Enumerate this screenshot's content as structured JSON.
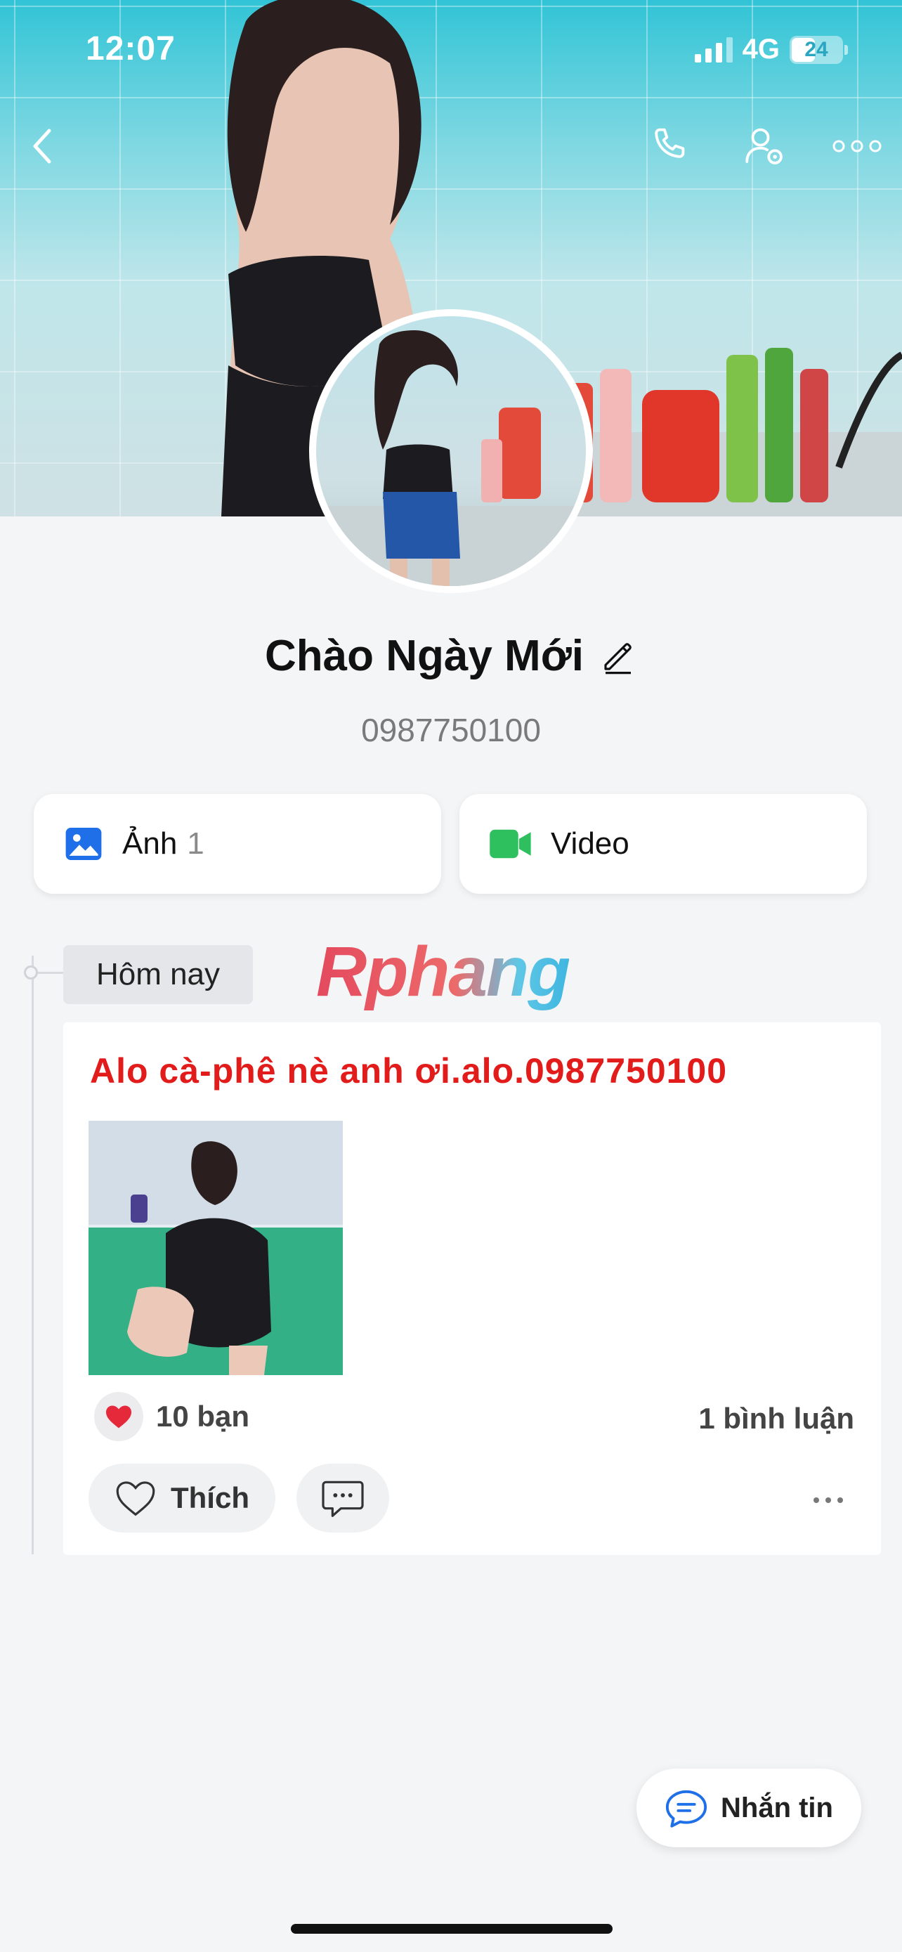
{
  "status": {
    "time": "12:07",
    "network": "4G",
    "battery": "24"
  },
  "profile": {
    "name": "Chào Ngày Mới",
    "phone": "0987750100"
  },
  "media": {
    "photos_label": "Ảnh",
    "photos_count": "1",
    "video_label": "Video"
  },
  "timeline": {
    "date_chip": "Hôm nay",
    "watermark": "Rphang"
  },
  "post": {
    "text": "Alo cà-phê nè anh ơi.alo.0987750100",
    "reactions": "10 bạn",
    "comments": "1 bình luận",
    "like_label": "Thích"
  },
  "message_button": "Nhắn tin",
  "colors": {
    "accent_blue": "#1e6fe8",
    "video_green": "#2ec05f",
    "post_text_red": "#e21b1b",
    "heart_red": "#e5283a"
  },
  "icons": [
    "back-icon",
    "phone-icon",
    "user-settings-icon",
    "more-icon",
    "edit-pencil-icon",
    "image-icon",
    "video-camera-icon",
    "heart-icon",
    "comment-icon",
    "chat-bubble-icon"
  ]
}
